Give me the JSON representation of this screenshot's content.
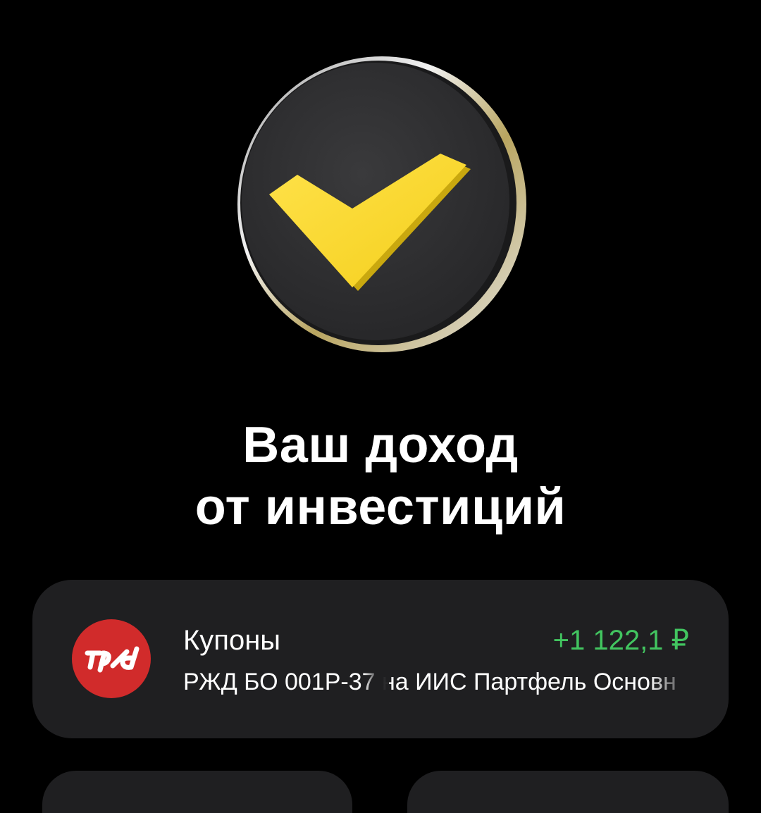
{
  "hero": {
    "icon": "yellow-checkmark-coin-icon",
    "accent_color": "#f7d72a"
  },
  "headline": {
    "line1": "Ваш доход",
    "line2": "от инвестиций"
  },
  "income_card": {
    "logo": "rzd-logo-icon",
    "logo_color": "#d12b2b",
    "title": "Купоны",
    "amount": "+1 122,1 ₽",
    "amount_color": "#42c560",
    "subtitle": "РЖД БО 001Р-37 на ИИС Партфель Основн"
  }
}
